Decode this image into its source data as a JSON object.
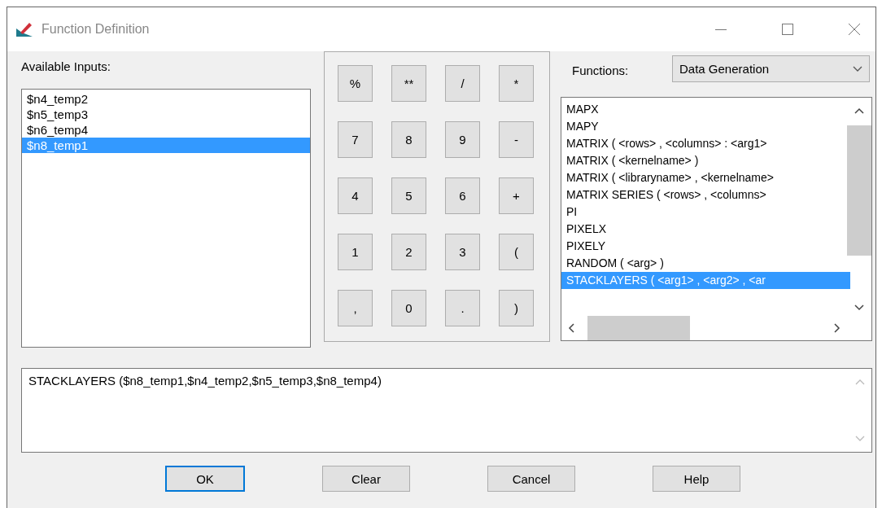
{
  "window": {
    "title": "Function Definition"
  },
  "available_inputs": {
    "label": "Available Inputs:",
    "items": [
      {
        "text": "$n4_temp2",
        "selected": false
      },
      {
        "text": "$n5_temp3",
        "selected": false
      },
      {
        "text": "$n6_temp4",
        "selected": false
      },
      {
        "text": "$n8_temp1",
        "selected": true
      }
    ]
  },
  "keypad": [
    "%",
    "**",
    "/",
    "*",
    "7",
    "8",
    "9",
    "-",
    "4",
    "5",
    "6",
    "+",
    "1",
    "2",
    "3",
    "(",
    ",",
    "0",
    ".",
    ")"
  ],
  "functions": {
    "label": "Functions:",
    "category": "Data Generation",
    "items": [
      {
        "text": "MAPX",
        "selected": false
      },
      {
        "text": "MAPY",
        "selected": false
      },
      {
        "text": "MATRIX ( <rows> , <columns> : <arg1>",
        "selected": false
      },
      {
        "text": "MATRIX ( <kernelname> )",
        "selected": false
      },
      {
        "text": "MATRIX ( <libraryname> , <kernelname>",
        "selected": false
      },
      {
        "text": "MATRIX SERIES ( <rows> , <columns>",
        "selected": false
      },
      {
        "text": "PI",
        "selected": false
      },
      {
        "text": "PIXELX",
        "selected": false
      },
      {
        "text": "PIXELY",
        "selected": false
      },
      {
        "text": "RANDOM ( <arg> )",
        "selected": false
      },
      {
        "text": "STACKLAYERS ( <arg1> , <arg2> , <ar",
        "selected": true
      }
    ]
  },
  "expression": "STACKLAYERS ($n8_temp1,$n4_temp2,$n5_temp3,$n8_temp4)",
  "buttons": [
    {
      "label": "OK",
      "focused": true
    },
    {
      "label": "Clear",
      "focused": false
    },
    {
      "label": "Cancel",
      "focused": false
    },
    {
      "label": "Help",
      "focused": false
    }
  ]
}
